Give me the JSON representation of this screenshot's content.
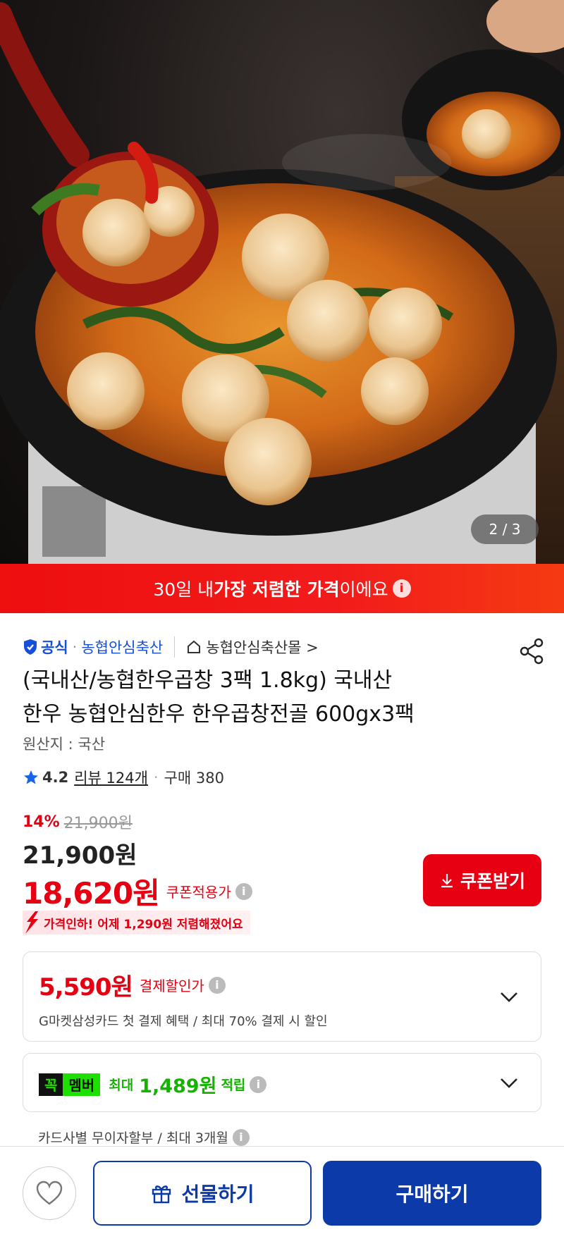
{
  "hero": {
    "image_alt": "spicy beef tripe hot pot with dumplings",
    "page_indicator": "2 / 3"
  },
  "banner": {
    "prefix": "30일 내 ",
    "highlight": "가장 저렴한 가격",
    "suffix": "이에요"
  },
  "seller": {
    "official_label": "공식",
    "dot": "·",
    "name": "농협안심축산",
    "mall_link": "농협안심축산몰 >"
  },
  "product": {
    "title_line1": "(국내산/농협한우곱창 3팩 1.8kg) 국내산",
    "title_line2": "한우 농협안심한우 한우곱창전골 600gx3팩",
    "origin": "원산지 : 국산"
  },
  "rating": {
    "score": "4.2",
    "reviews": "리뷰 124개",
    "sep": "·",
    "purchases": "구매 380"
  },
  "pricing": {
    "discount_pct": "14%",
    "original_price": "21,900원",
    "price": "21,900원",
    "coupon_price": "18,620원",
    "coupon_label": "쿠폰적용가",
    "coupon_button": "쿠폰받기",
    "price_drop_note": "가격인하! 어제 1,290원 저렴해졌어요"
  },
  "payment_discount": {
    "amount": "5,590원",
    "label": "결제할인가",
    "description": "G마켓삼성카드 첫 결제 혜택 / 최대 70% 결제 시 할인"
  },
  "membership": {
    "badge_a": "꼭",
    "badge_b": "멤버",
    "max_label": "최대",
    "points": "1,489원",
    "earn_label": "적립"
  },
  "installment": "카드사별 무이자할부 / 최대 3개월",
  "bottom_bar": {
    "gift_label": "선물하기",
    "buy_label": "구매하기"
  },
  "colors": {
    "accent_red": "#e60012",
    "brand_blue": "#0c3aa8",
    "member_green": "#1ee000"
  }
}
